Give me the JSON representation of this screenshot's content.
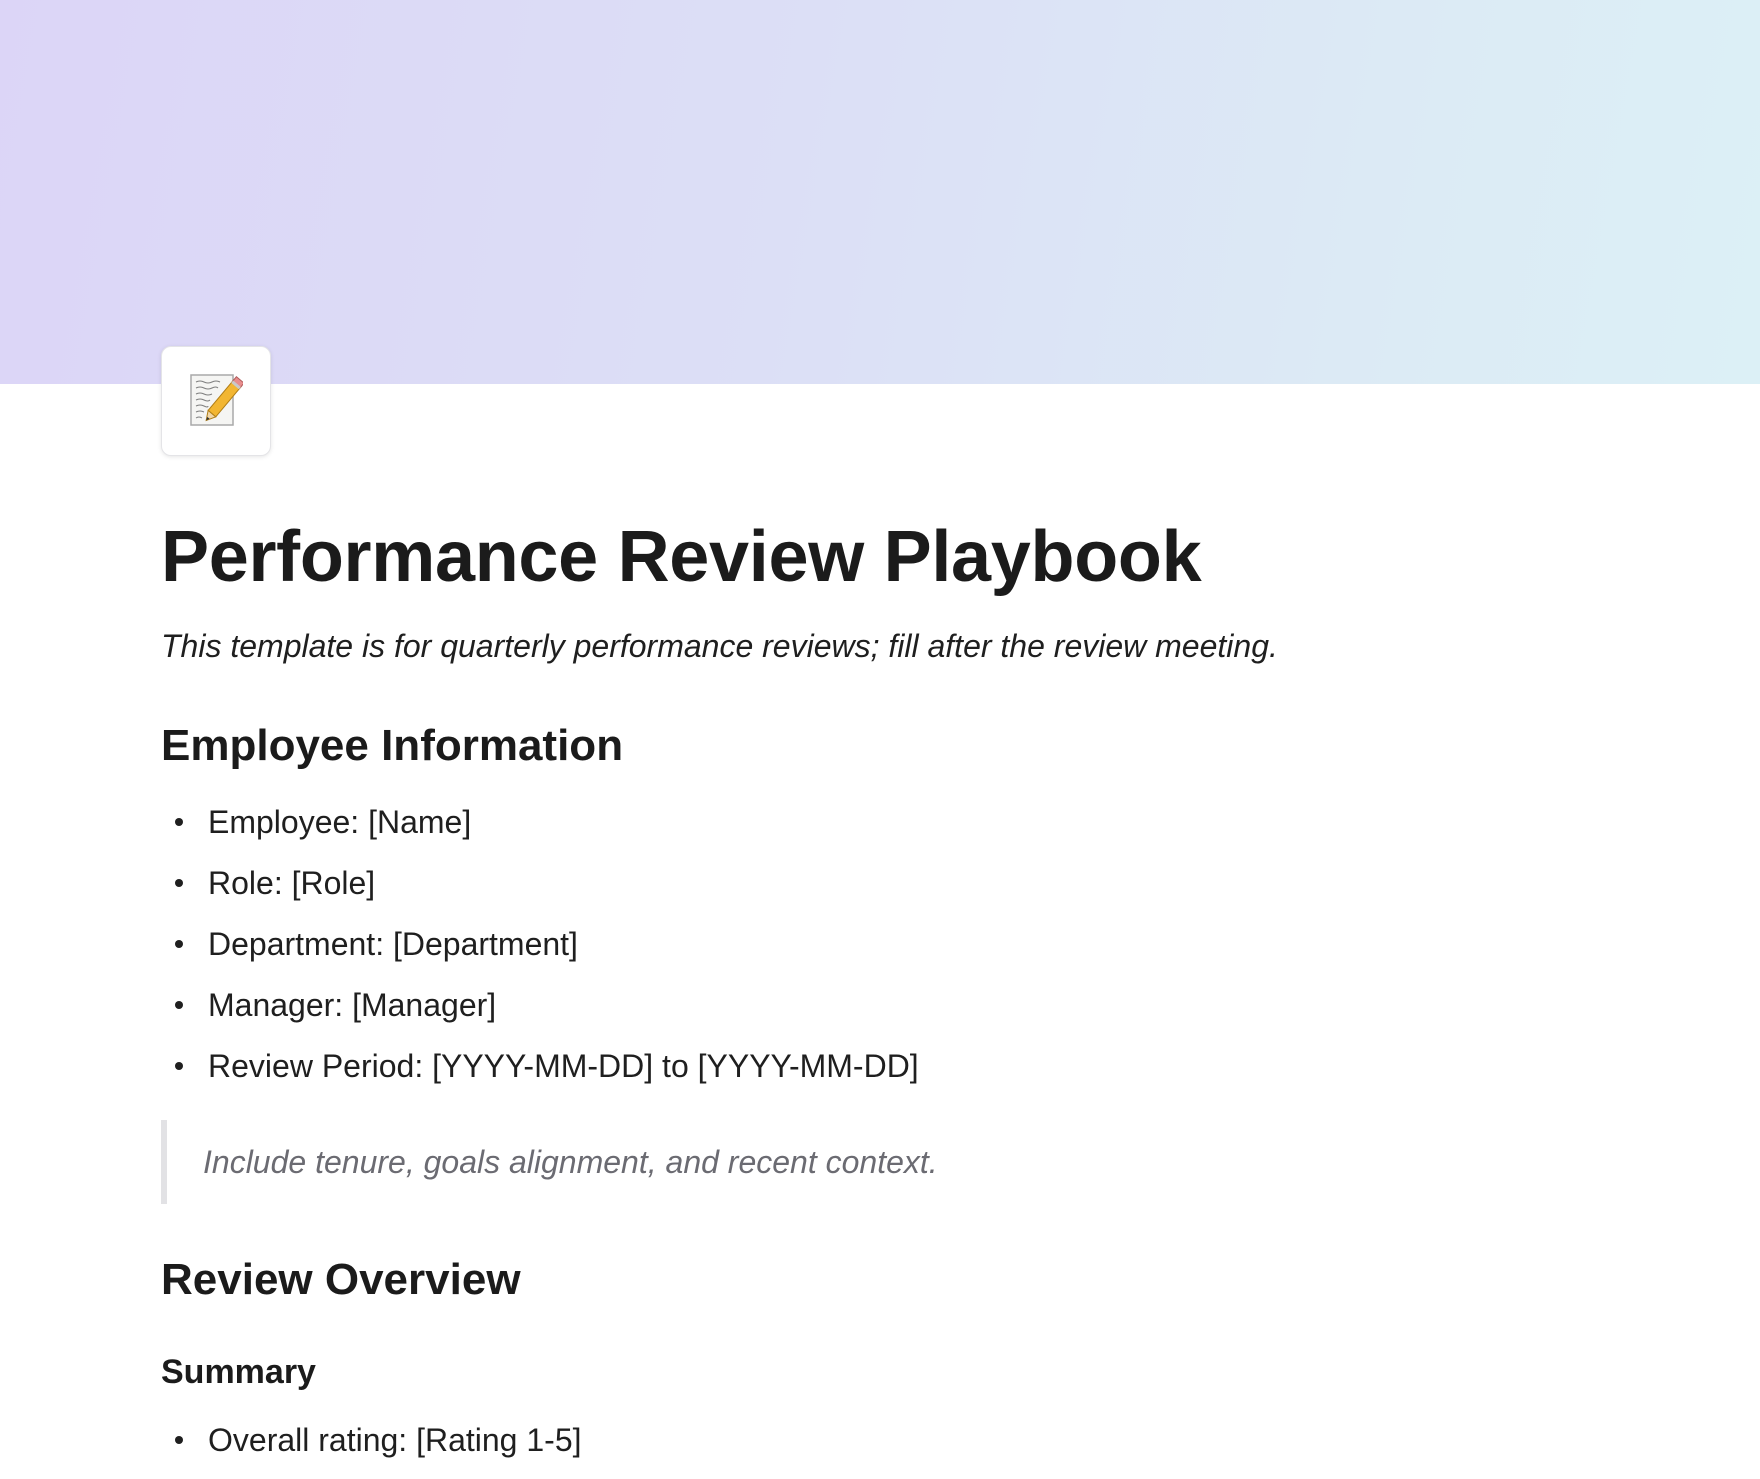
{
  "page": {
    "icon": "memo-icon",
    "title": "Performance Review Playbook",
    "intro": "This template is for quarterly performance reviews; fill after the review meeting."
  },
  "sections": {
    "employee_info": {
      "heading": "Employee Information",
      "items": [
        "Employee: [Name]",
        "Role: [Role]",
        "Department: [Department]",
        "Manager: [Manager]",
        "Review Period: [YYYY-MM-DD] to [YYYY-MM-DD]"
      ],
      "callout": "Include tenure, goals alignment, and recent context."
    },
    "review_overview": {
      "heading": "Review Overview",
      "summary": {
        "heading": "Summary",
        "items": [
          "Overall rating: [Rating 1-5]"
        ]
      }
    }
  },
  "colors": {
    "cover_start": "#dcd5f7",
    "cover_end": "#dcf0f6",
    "text": "#1f1f1f",
    "callout_text": "#6b6b72",
    "callout_border": "#e2e2e5"
  }
}
